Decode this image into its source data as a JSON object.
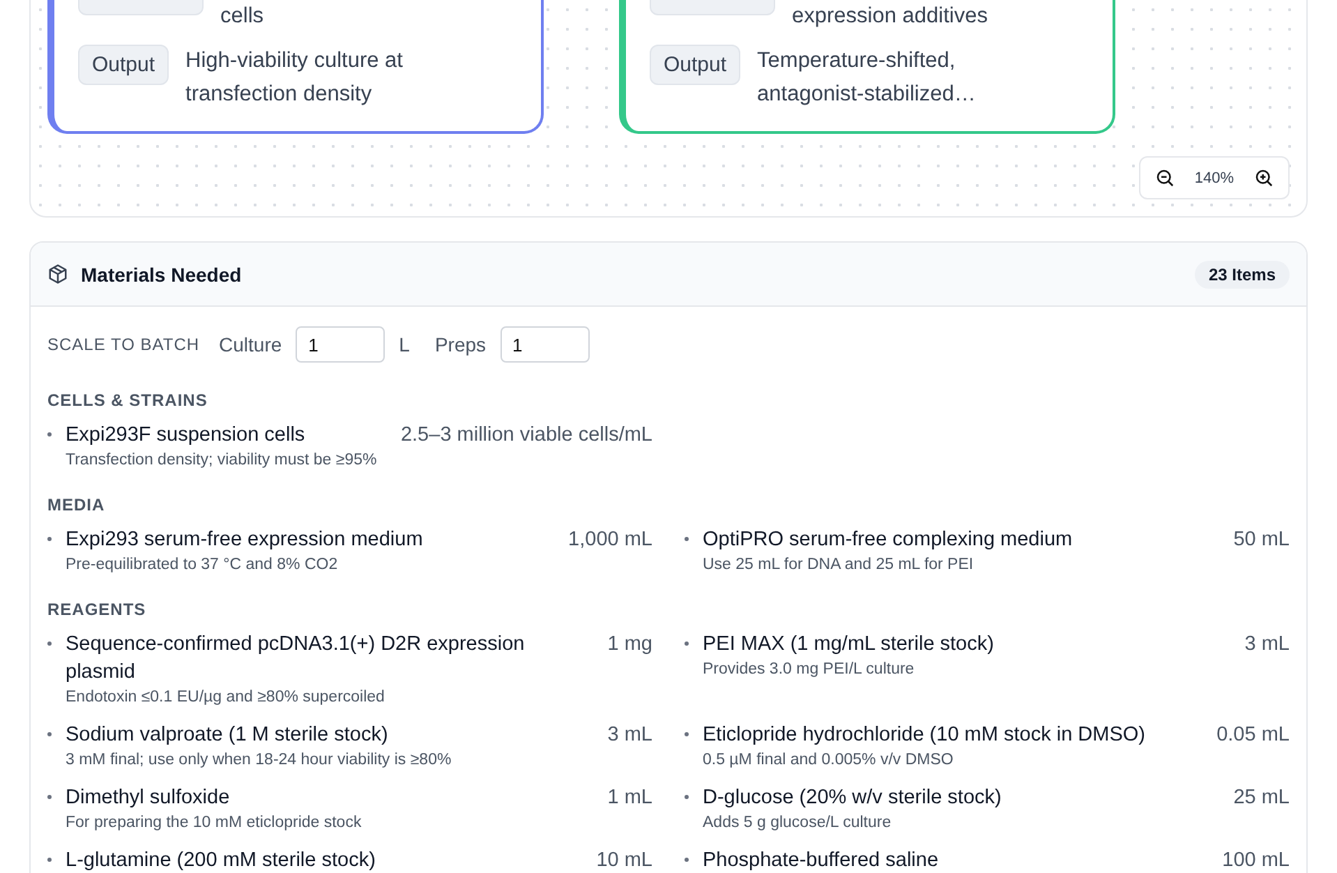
{
  "canvas": {
    "cards": [
      {
        "color": "#6f7ff0",
        "rows": [
          {
            "kind": "cut",
            "value": "cells"
          },
          {
            "kind": "full",
            "tag": "Output",
            "value": "High-viability culture at transfection density"
          }
        ]
      },
      {
        "color": "#34c88a",
        "rows": [
          {
            "kind": "cut",
            "value": "expression additives"
          },
          {
            "kind": "full",
            "tag": "Output",
            "value": "Temperature-shifted, antagonist-stabilized…"
          }
        ]
      }
    ],
    "zoom": {
      "reading": "140%"
    }
  },
  "materials": {
    "title": "Materials Needed",
    "count": "23 Items",
    "scale": {
      "label": "SCALE TO BATCH",
      "fields": [
        {
          "label": "Culture",
          "value": "1",
          "unit": "L"
        },
        {
          "label": "Preps",
          "value": "1"
        }
      ]
    },
    "sections": [
      {
        "title": "CELLS & STRAINS",
        "items": [
          {
            "name": "Expi293F suspension cells",
            "note": "Transfection density; viability must be ≥95%",
            "amount": "2.5–3 million viable cells/mL"
          }
        ]
      },
      {
        "title": "MEDIA",
        "items": [
          {
            "name": "Expi293 serum-free expression medium",
            "note": "Pre-equilibrated to 37 °C and 8% CO2",
            "amount": "1,000 mL"
          },
          {
            "name": "OptiPRO serum-free complexing medium",
            "note": "Use 25 mL for DNA and 25 mL for PEI",
            "amount": "50 mL"
          }
        ]
      },
      {
        "title": "REAGENTS",
        "items": [
          {
            "name": "Sequence-confirmed pcDNA3.1(+) D2R expression plasmid",
            "note": "Endotoxin ≤0.1 EU/µg and ≥80% supercoiled",
            "amount": "1 mg"
          },
          {
            "name": "PEI MAX (1 mg/mL sterile stock)",
            "note": "Provides 3.0 mg PEI/L culture",
            "amount": "3 mL"
          },
          {
            "name": "Sodium valproate (1 M sterile stock)",
            "note": "3 mM final; use only when 18-24 hour viability is ≥80%",
            "amount": "3 mL"
          },
          {
            "name": "Eticlopride hydrochloride (10 mM stock in DMSO)",
            "note": "0.5 µM final and 0.005% v/v DMSO",
            "amount": "0.05 mL"
          },
          {
            "name": "Dimethyl sulfoxide",
            "note": "For preparing the 10 mM eticlopride stock",
            "amount": "1 mL"
          },
          {
            "name": "D-glucose (20% w/v sterile stock)",
            "note": "Adds 5 g glucose/L culture",
            "amount": "25 mL"
          },
          {
            "name": "L-glutamine (200 mM sterile stock)",
            "amount": "10 mL"
          },
          {
            "name": "Phosphate-buffered saline",
            "amount": "100 mL"
          }
        ]
      }
    ]
  }
}
